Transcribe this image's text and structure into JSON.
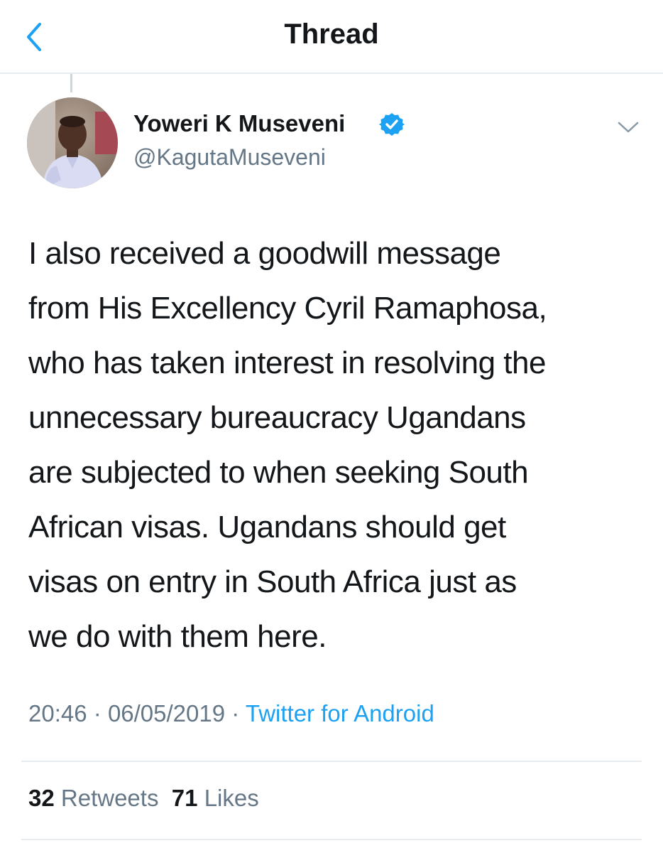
{
  "header": {
    "title": "Thread",
    "back_icon": "chevron-left-icon",
    "accent_color": "#1da1f2"
  },
  "tweet": {
    "author": {
      "name": "Yoweri K Museveni",
      "handle": "@KagutaMuseveni",
      "verified": true,
      "avatar_icon": "profile-photo"
    },
    "text_lines": [
      "I also received a goodwill message",
      "from His Excellency Cyril Ramaphosa,",
      "who has taken interest in resolving the",
      "unnecessary bureaucracy Ugandans",
      "are subjected to when seeking South",
      "African visas. Ugandans should get",
      "visas on entry in South Africa just as",
      "we do with them here."
    ],
    "time": "20:46",
    "date": "06/05/2019",
    "separator": "·",
    "source": "Twitter for Android",
    "stats": {
      "retweets_count": "32",
      "retweets_label": "Retweets",
      "likes_count": "71",
      "likes_label": "Likes"
    }
  }
}
